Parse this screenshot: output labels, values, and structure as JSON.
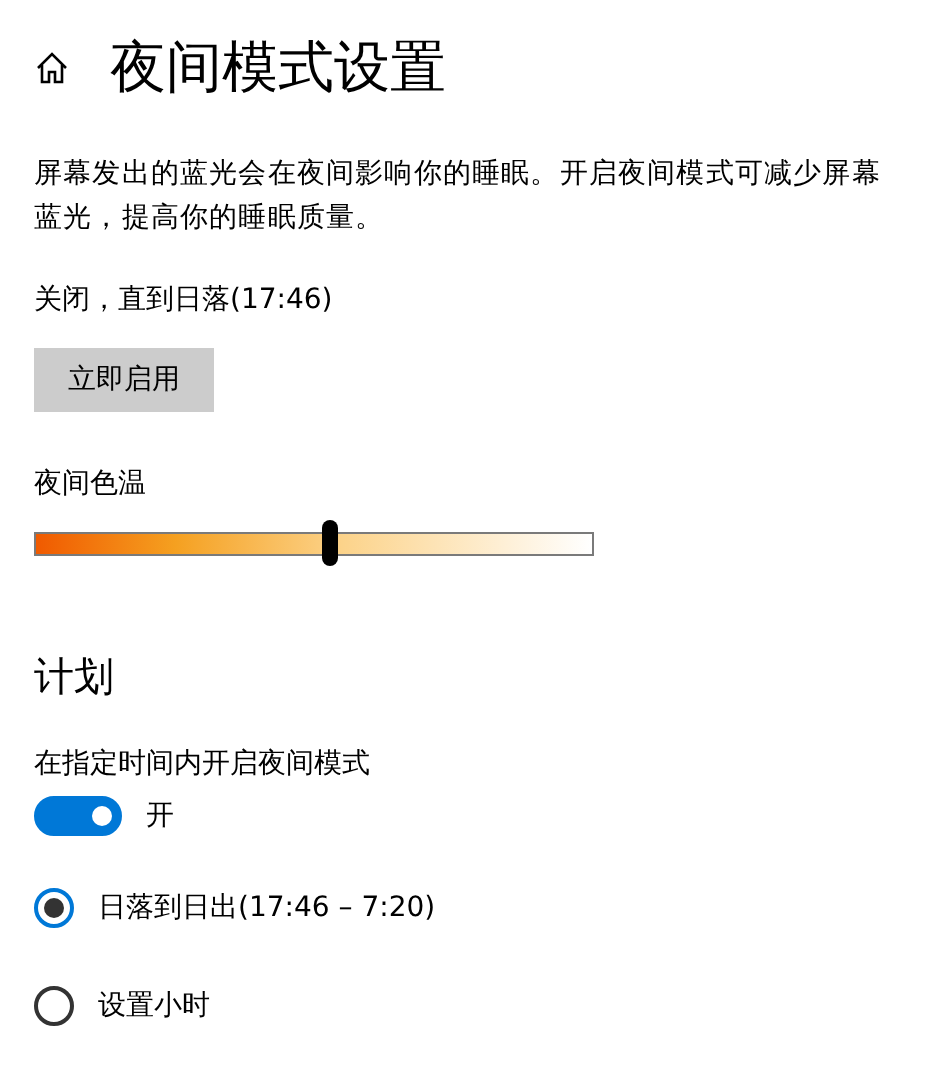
{
  "header": {
    "title": "夜间模式设置"
  },
  "description": "屏幕发出的蓝光会在夜间影响你的睡眠。开启夜间模式可减少屏幕蓝光，提高你的睡眠质量。",
  "status": "关闭，直到日落(17:46)",
  "enable_button": {
    "label": "立即启用"
  },
  "color_temperature": {
    "label": "夜间色温",
    "level": 0.53
  },
  "schedule": {
    "heading": "计划",
    "toggle_label": "在指定时间内开启夜间模式",
    "on": true,
    "toggle_text": "开",
    "options": [
      {
        "label": "日落到日出(17:46 – 7:20)",
        "selected": true
      },
      {
        "label": "设置小时",
        "selected": false
      }
    ]
  }
}
